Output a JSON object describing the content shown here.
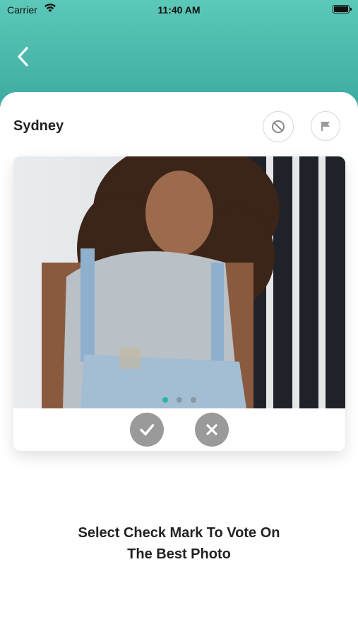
{
  "status_bar": {
    "carrier": "Carrier",
    "time": "11:40 AM"
  },
  "header": {
    "back_icon": "chevron-left-icon"
  },
  "profile": {
    "name": "Sydney"
  },
  "actions": {
    "block_icon": "block-icon",
    "flag_icon": "flag-icon"
  },
  "gallery": {
    "photo_count": 3,
    "active_index": 0
  },
  "vote": {
    "approve_icon": "check-icon",
    "reject_icon": "close-icon"
  },
  "instruction": {
    "line1": "Select Check Mark To Vote On",
    "line2": "The Best Photo"
  },
  "colors": {
    "header_top": "#5cc8b8",
    "header_bottom": "#3aa79f",
    "active_dot": "#2bb5a6",
    "vote_button": "#9a9a9a"
  }
}
